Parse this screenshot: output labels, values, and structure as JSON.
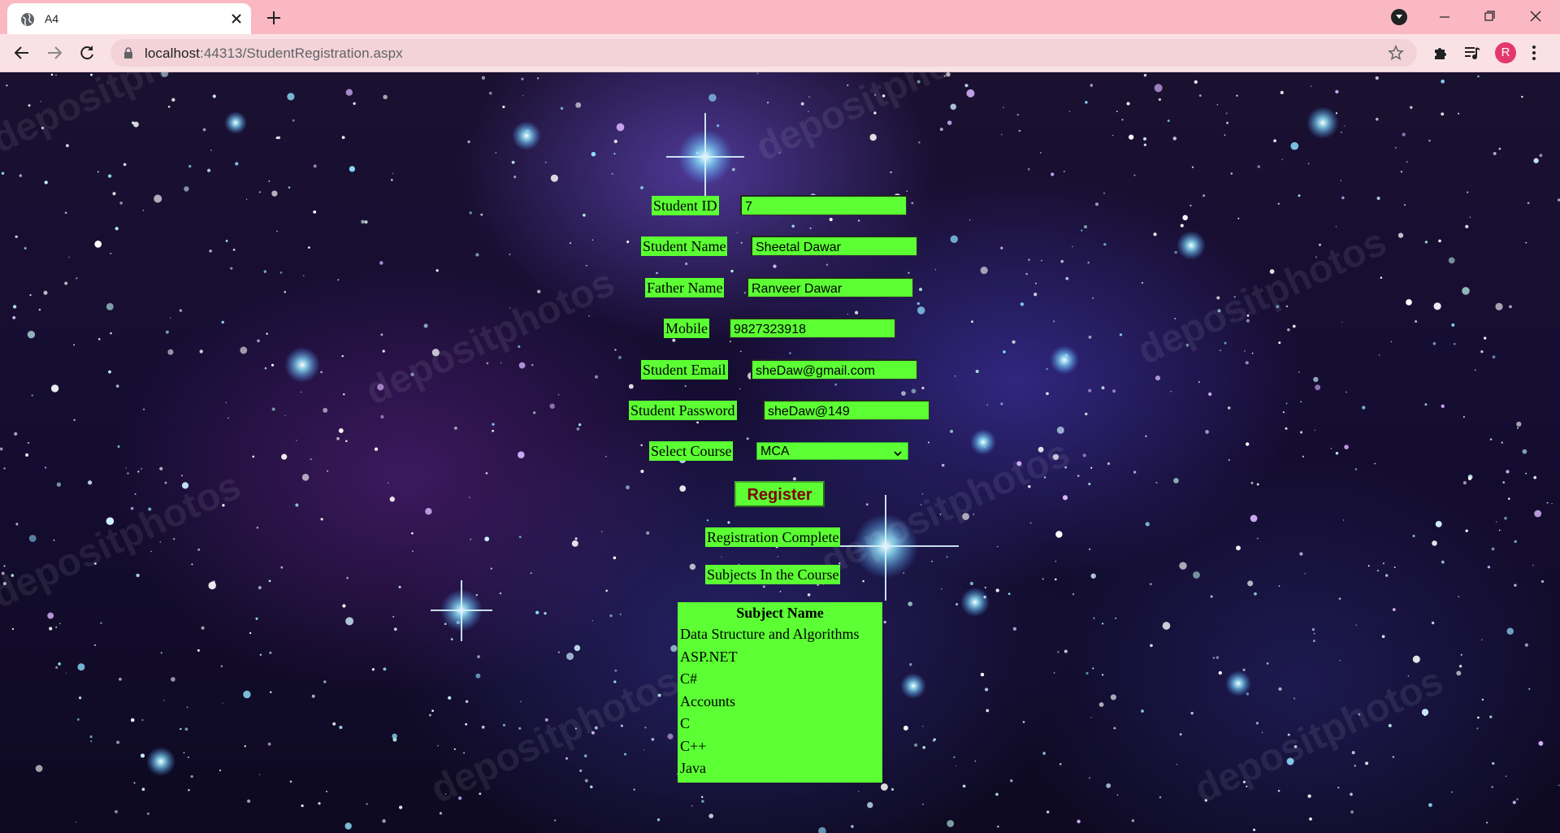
{
  "browser": {
    "tab_title": "A4",
    "url_host": "localhost",
    "url_rest": ":44313/StudentRegistration.aspx",
    "profile_initial": "R"
  },
  "form": {
    "student_id_label": "Student ID",
    "student_id_value": "7",
    "student_name_label": "Student Name",
    "student_name_value": "Sheetal Dawar",
    "father_name_label": "Father Name",
    "father_name_value": "Ranveer Dawar",
    "mobile_label": "Mobile",
    "mobile_value": "9827323918",
    "email_label": "Student Email",
    "email_value": "sheDaw@gmail.com",
    "password_label": "Student Password",
    "password_value": "sheDaw@149",
    "course_label": "Select Course",
    "course_value": "MCA",
    "register_label": "Register"
  },
  "status": {
    "message": "Registration Complete",
    "subjects_heading": "Subjects In the Course"
  },
  "subjects_table": {
    "header": "Subject Name",
    "rows": [
      "Data Structure and Algorithms",
      "ASP.NET",
      "C#",
      "Accounts",
      "C",
      "C++",
      "Java"
    ]
  },
  "colors": {
    "field_green": "#5bff33",
    "button_text": "#800000",
    "tabstrip": "#f9b8c2",
    "toolbar": "#fae1e5",
    "avatar": "#e3386e"
  },
  "icons": [
    "globe-icon",
    "close-icon",
    "plus-icon",
    "tab-search-icon",
    "minimize-icon",
    "restore-icon",
    "window-close-icon",
    "back-icon",
    "forward-icon",
    "reload-icon",
    "lock-icon",
    "star-icon",
    "puzzle-icon",
    "media-icon",
    "kebab-menu-icon",
    "chevron-down-icon"
  ]
}
